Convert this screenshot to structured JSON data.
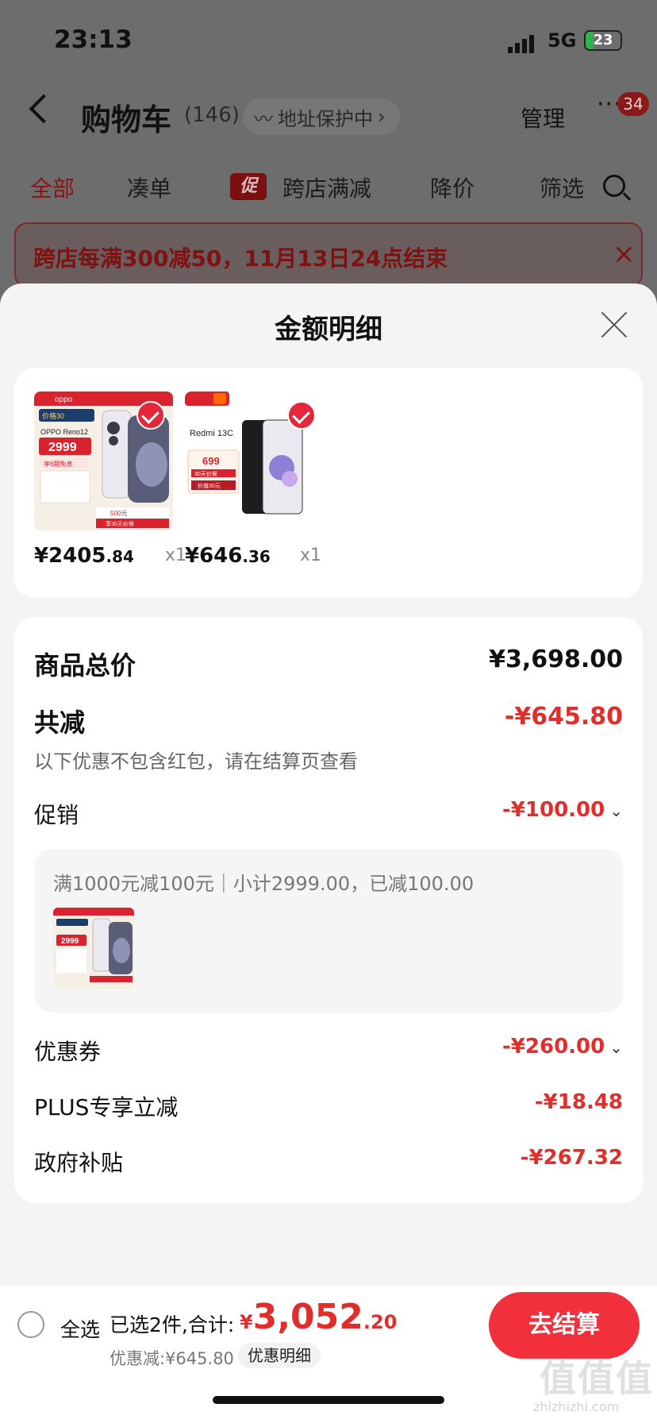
{
  "status": {
    "time": "23:13",
    "network": "5G",
    "battery": "23",
    "battery_fraction": 0.23
  },
  "nav": {
    "title": "购物车",
    "count": "(146)",
    "address": "地址保护中",
    "manage": "管理",
    "more": "···",
    "badge": "34"
  },
  "filters": {
    "all": "全部",
    "combine": "凑单",
    "promo_tag": "促",
    "cross_store": "跨店满减",
    "price_drop": "降价",
    "filter": "筛选"
  },
  "notice": {
    "text": "跨店每满300减50，11月13日24点结束",
    "close": "×"
  },
  "sheet": {
    "title": "金额明细"
  },
  "products": [
    {
      "brand": "oppo",
      "price_int": "¥2405",
      "price_dec": ".84",
      "qty": "x1"
    },
    {
      "brand": "Redmi 13C",
      "price_int": "¥646",
      "price_dec": ".36",
      "qty": "x1"
    }
  ],
  "product_art": {
    "p1": {
      "model": "OPPO Reno12",
      "price": "2999",
      "top": "价格30",
      "tag": "享6期免息",
      "bottom": "享30天价保",
      "bonus": "500元"
    },
    "p2": {
      "model": "Redmi 13C",
      "price": "699",
      "tag": "30天价保",
      "bottom": "价值30元"
    }
  },
  "details": {
    "total_label": "商品总价",
    "total_value": "¥3,698.00",
    "reduce_label": "共减",
    "reduce_value": "-¥645.80",
    "reduce_note": "以下优惠不包含红包，请在结算页查看",
    "promo_label": "促销",
    "promo_value": "-¥100.00",
    "promo_rule": "满1000元减100元｜小计2999.00，已减100.00",
    "coupon_label": "优惠券",
    "coupon_value": "-¥260.00",
    "plus_label": "PLUS专享立减",
    "plus_value": "-¥18.48",
    "gov_label": "政府补贴",
    "gov_value": "-¥267.32"
  },
  "bottom": {
    "select_all": "全选",
    "selected": "已选2件,合计:",
    "currency": "¥",
    "total_int": "3,052",
    "total_dec": ".20",
    "discount": "优惠减:¥645.80",
    "detail": "优惠明细",
    "checkout": "去结算"
  },
  "watermark": {
    "text": "值值值",
    "url": "zhizhizhi.com"
  },
  "colors": {
    "accent": "#e22d2d",
    "checkout": "#f1303b",
    "check": "#e4273b"
  }
}
